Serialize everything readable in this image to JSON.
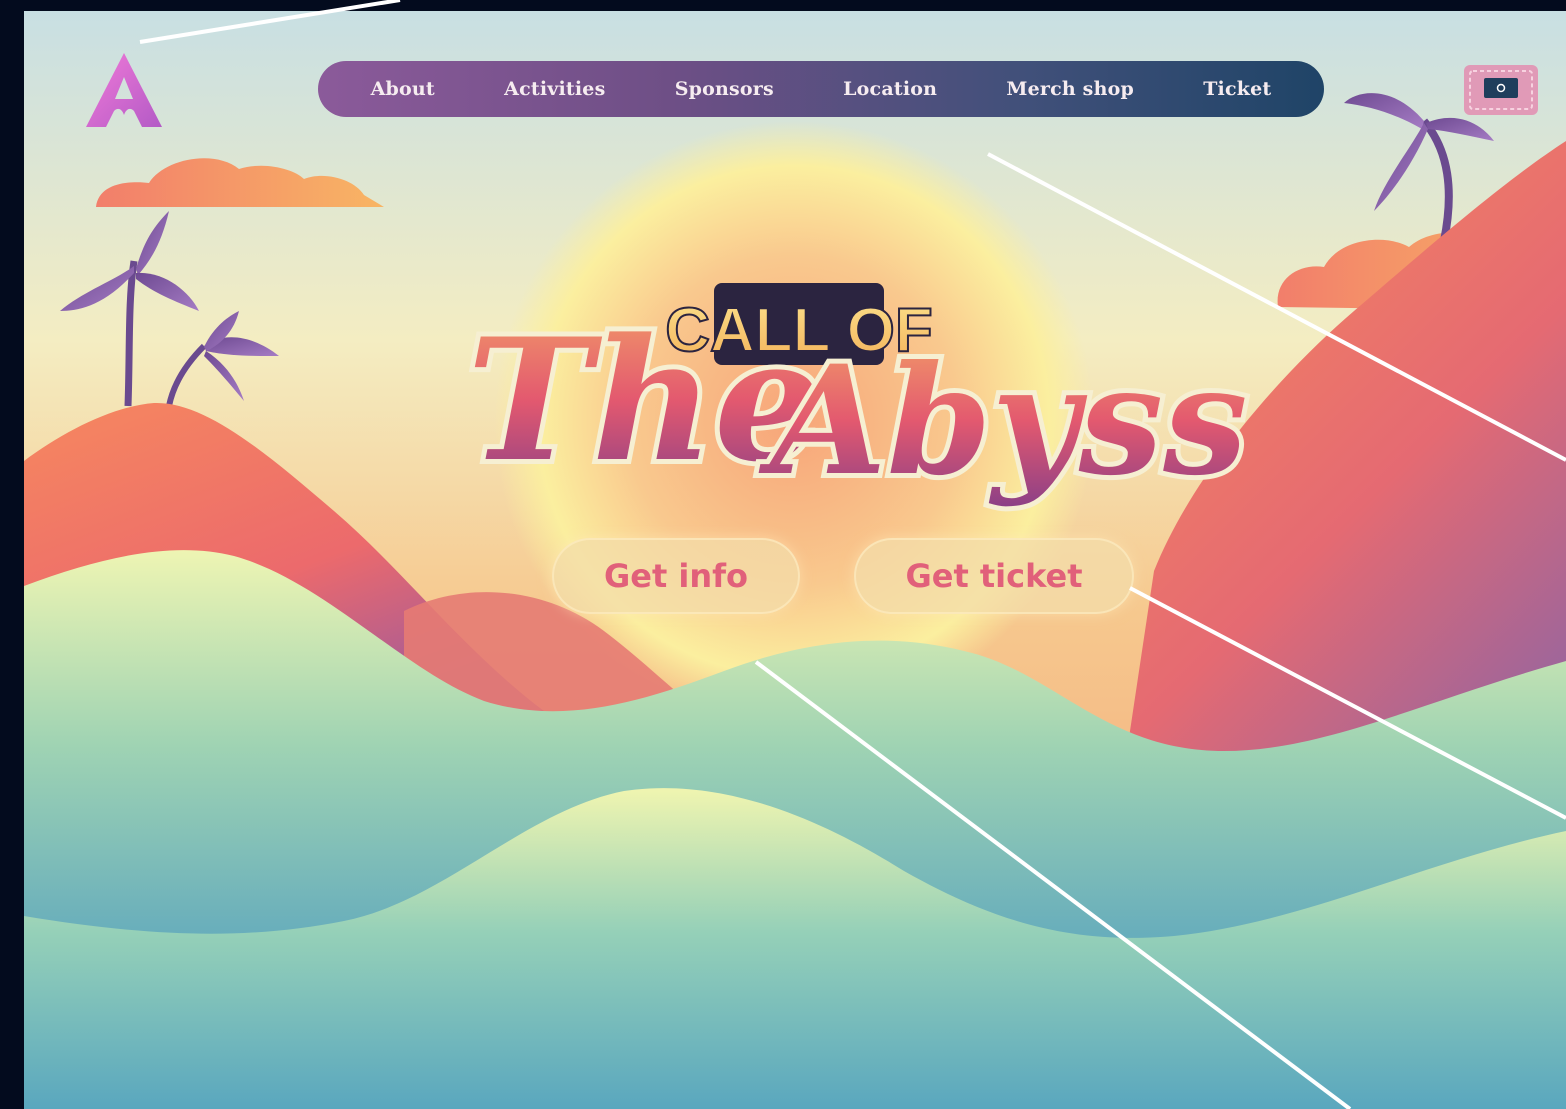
{
  "nav": {
    "items": [
      {
        "label": "About"
      },
      {
        "label": "Activities"
      },
      {
        "label": "Sponsors"
      },
      {
        "label": "Location"
      },
      {
        "label": "Merch shop"
      },
      {
        "label": "Ticket"
      }
    ]
  },
  "hero": {
    "title_small": "CALL OF",
    "title_word1": "The",
    "title_word2": "Abyss",
    "buttons": {
      "info": "Get info",
      "ticket": "Get ticket"
    }
  },
  "colors": {
    "background": "#030b1e",
    "sky_top": "#cfe3e4",
    "sun": "#fbef9f",
    "mountain": "#f07a62",
    "wave_green": "#e9f2b0",
    "wave_blue": "#5ba8bd",
    "nav_left": "#8b5a9a",
    "nav_right": "#1f4467",
    "button_text": "#e1607a",
    "annotation_line": "#ffffff"
  },
  "icons": {
    "logo": "stylized-a-logo",
    "ticket": "ticket-icon"
  }
}
